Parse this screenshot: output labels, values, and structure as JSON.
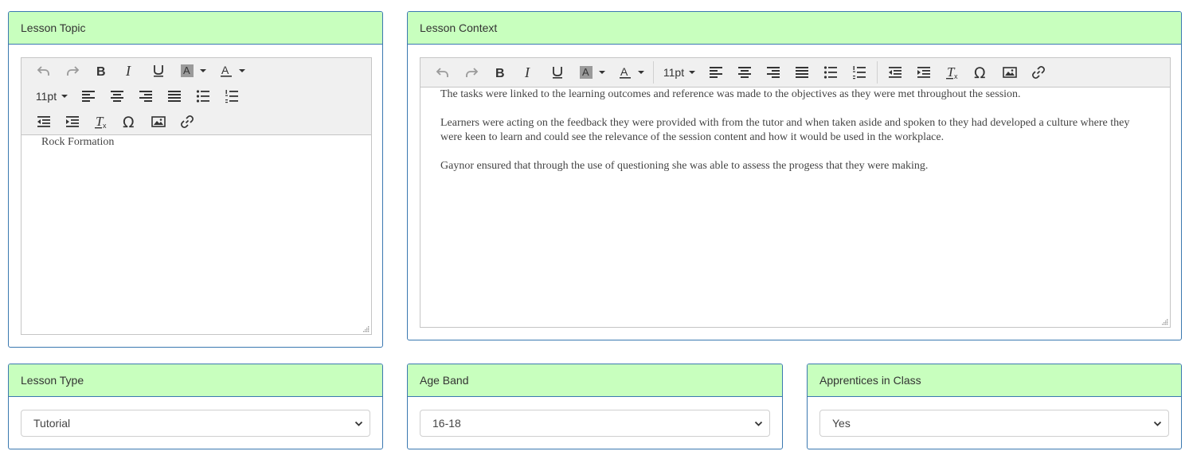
{
  "panels": {
    "lesson_topic": {
      "title": "Lesson Topic",
      "font_size": "11pt",
      "content": "Rock Formation"
    },
    "lesson_context": {
      "title": "Lesson Context",
      "font_size": "11pt",
      "paragraphs": [
        "The tasks were linked to the learning outcomes and reference was made to the objectives as they were met throughout the session.",
        "Learners were acting on the feedback they were provided with from the tutor and when taken aside and spoken to they had developed a culture where they were keen to learn and could see the relevance of the session content and how it would be used in the workplace.",
        "Gaynor ensured that through the use of questioning she was able to assess the progess that they were making."
      ]
    },
    "lesson_type": {
      "title": "Lesson Type",
      "selected": "Tutorial"
    },
    "age_band": {
      "title": "Age Band",
      "selected": "16-18"
    },
    "apprentices": {
      "title": "Apprentices in Class",
      "selected": "Yes"
    }
  },
  "toolbar_icons": [
    "undo-icon",
    "redo-icon",
    "bold-icon",
    "italic-icon",
    "underline-icon",
    "background-color-icon",
    "text-color-icon",
    "font-size",
    "align-left-icon",
    "align-center-icon",
    "align-right-icon",
    "justify-icon",
    "bullet-list-icon",
    "numbered-list-icon",
    "outdent-icon",
    "indent-icon",
    "clear-formatting-icon",
    "special-character-icon",
    "image-icon",
    "link-icon"
  ],
  "colors": {
    "panel_heading_bg": "#c8ffbe",
    "panel_border": "#3a78b0",
    "toolbar_bg": "#f0f0f0"
  }
}
